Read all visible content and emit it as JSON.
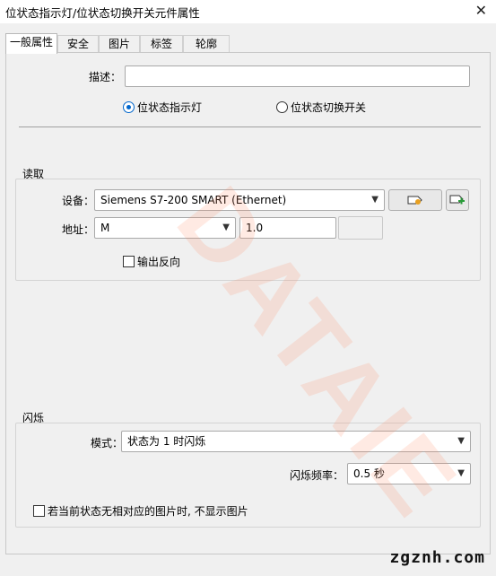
{
  "window": {
    "title": "位状态指示灯/位状态切换开关元件属性",
    "close_glyph": "✕"
  },
  "tabs": [
    {
      "label": "一般属性",
      "active": true
    },
    {
      "label": "安全"
    },
    {
      "label": "图片"
    },
    {
      "label": "标签"
    },
    {
      "label": "轮廓"
    }
  ],
  "general": {
    "description_label": "描述：",
    "description_value": "",
    "radio_indicator": "位状态指示灯",
    "radio_switch": "位状态切换开关",
    "selected": "位状态指示灯"
  },
  "read": {
    "title": "读取",
    "device_label": "设备：",
    "device_value": "Siemens S7-200 SMART (Ethernet)",
    "address_label": "地址：",
    "address_type": "M",
    "address_value": "1.0",
    "invert_label": "输出反向"
  },
  "blink": {
    "title": "闪烁",
    "mode_label": "模式：",
    "mode_value": "状态为 1 时闪烁",
    "freq_label": "闪烁频率：",
    "freq_value": "0.5 秒",
    "hide_picture_label": "若当前状态无相对应的图片时, 不显示图片"
  },
  "watermark": "DATAIE",
  "brand": "zgznh.com",
  "colors": {
    "accent": "#0066cc",
    "watermark": "#ff8c64"
  },
  "icons": {
    "device_settings": "tag-settings-icon",
    "device_add": "tag-add-icon"
  }
}
